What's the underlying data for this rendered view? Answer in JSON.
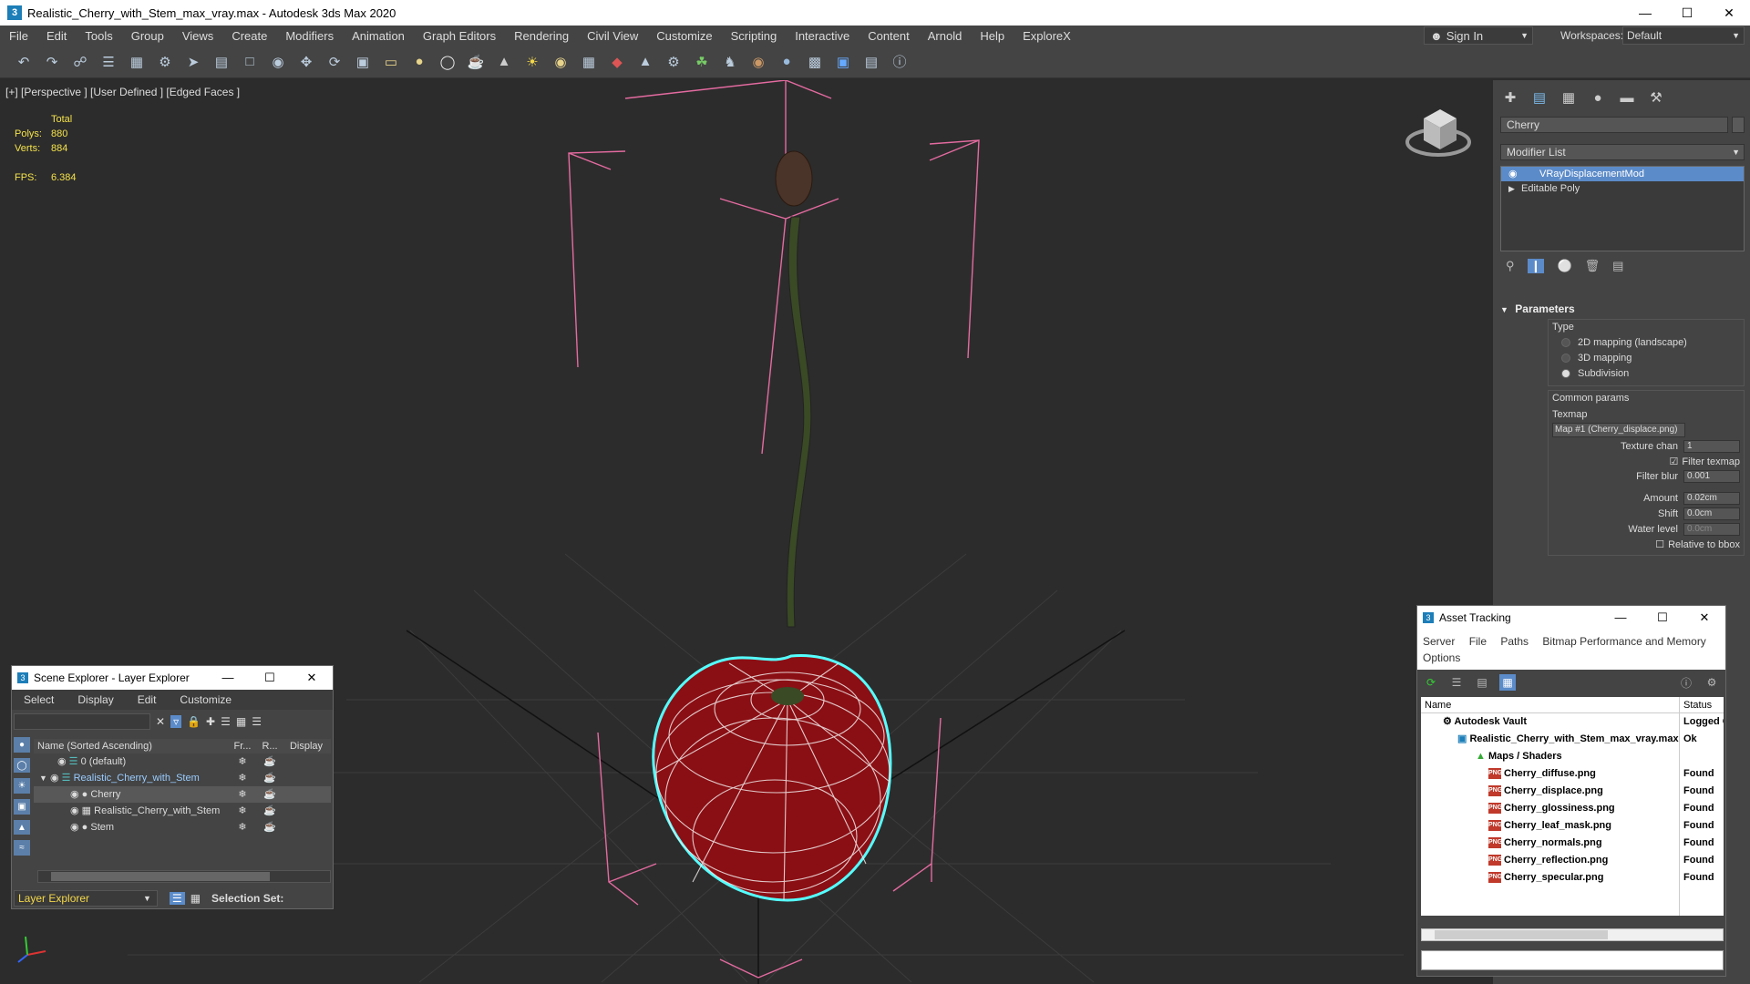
{
  "window": {
    "title": "Realistic_Cherry_with_Stem_max_vray.max - Autodesk 3ds Max 2020",
    "app_icon": "3"
  },
  "menus": [
    "File",
    "Edit",
    "Tools",
    "Group",
    "Views",
    "Create",
    "Modifiers",
    "Animation",
    "Graph Editors",
    "Rendering",
    "Civil View",
    "Customize",
    "Scripting",
    "Interactive",
    "Content",
    "Arnold",
    "Help",
    "ExploreX"
  ],
  "account": {
    "sign_in": "Sign In",
    "workspaces_label": "Workspaces:",
    "workspace": "Default"
  },
  "viewport": {
    "label": "[+] [Perspective ] [User Defined ] [Edged Faces ]",
    "stats": {
      "total": "Total",
      "polys_label": "Polys:",
      "polys": "880",
      "verts_label": "Verts:",
      "verts": "884",
      "fps_label": "FPS:",
      "fps": "6.384"
    }
  },
  "command_panel": {
    "object_name": "Cherry",
    "modifier_list": "Modifier List",
    "stack": [
      "VRayDisplacementMod",
      "Editable Poly"
    ],
    "rollout": "Parameters",
    "type_label": "Type",
    "type_options": [
      "2D mapping (landscape)",
      "3D mapping",
      "Subdivision"
    ],
    "type_selected": 2,
    "common_params": "Common params",
    "texmap_label": "Texmap",
    "texmap_value": "Map #1 (Cherry_displace.png)",
    "texture_chan_label": "Texture chan",
    "texture_chan": "1",
    "filter_texmap": "Filter texmap",
    "filter_blur_label": "Filter blur",
    "filter_blur": "0.001",
    "amount_label": "Amount",
    "amount": "0.02cm",
    "shift_label": "Shift",
    "shift": "0.0cm",
    "water_level_label": "Water level",
    "water_level": "0.0cm",
    "relative_bbox": "Relative to bbox"
  },
  "scene_explorer": {
    "title": "Scene Explorer - Layer Explorer",
    "menus": [
      "Select",
      "Display",
      "Edit",
      "Customize"
    ],
    "columns": [
      "Name (Sorted Ascending)",
      "Fr...",
      "R...",
      "Display"
    ],
    "rows": [
      {
        "name": "0 (default)",
        "indent": 1
      },
      {
        "name": "Realistic_Cherry_with_Stem",
        "indent": 1,
        "highlight": true
      },
      {
        "name": "Cherry",
        "indent": 2,
        "selected": true
      },
      {
        "name": "Realistic_Cherry_with_Stem",
        "indent": 2
      },
      {
        "name": "Stem",
        "indent": 2
      }
    ],
    "layer_selector": "Layer Explorer",
    "selection_set": "Selection Set:"
  },
  "asset_tracking": {
    "title": "Asset Tracking",
    "menus": [
      "Server",
      "File",
      "Paths",
      "Bitmap Performance and Memory",
      "Options"
    ],
    "columns": [
      "Name",
      "Status"
    ],
    "rows": [
      {
        "name": "Autodesk Vault",
        "status": "Logged O",
        "indent": 1
      },
      {
        "name": "Realistic_Cherry_with_Stem_max_vray.max",
        "status": "Ok",
        "indent": 2
      },
      {
        "name": "Maps / Shaders",
        "status": "",
        "indent": 3
      },
      {
        "name": "Cherry_diffuse.png",
        "status": "Found",
        "indent": 4
      },
      {
        "name": "Cherry_displace.png",
        "status": "Found",
        "indent": 4
      },
      {
        "name": "Cherry_glossiness.png",
        "status": "Found",
        "indent": 4
      },
      {
        "name": "Cherry_leaf_mask.png",
        "status": "Found",
        "indent": 4
      },
      {
        "name": "Cherry_normals.png",
        "status": "Found",
        "indent": 4
      },
      {
        "name": "Cherry_reflection.png",
        "status": "Found",
        "indent": 4
      },
      {
        "name": "Cherry_specular.png",
        "status": "Found",
        "indent": 4
      }
    ]
  }
}
